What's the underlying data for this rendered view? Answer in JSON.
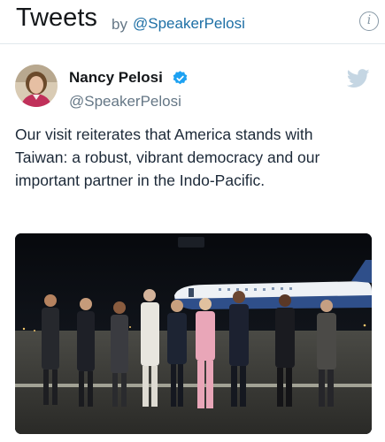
{
  "header": {
    "title": "Tweets",
    "by": "by",
    "handle": "@SpeakerPelosi",
    "info_icon": "info-icon"
  },
  "tweet": {
    "author_name": "Nancy Pelosi",
    "author_handle": "@SpeakerPelosi",
    "verified": true,
    "lines": [
      "Our visit reiterates that America stands with",
      "Taiwan: a robust, vibrant democracy and our",
      "important partner in the Indo-Pacific."
    ],
    "media_caption": "Photo: delegation standing on airport tarmac at night in front of aircraft"
  },
  "colors": {
    "accent": "#1da1f2",
    "handle_link": "#1d6fa5",
    "muted": "#657786"
  },
  "icons": [
    "info-icon",
    "verified-badge-icon",
    "twitter-bird-icon",
    "avatar"
  ]
}
